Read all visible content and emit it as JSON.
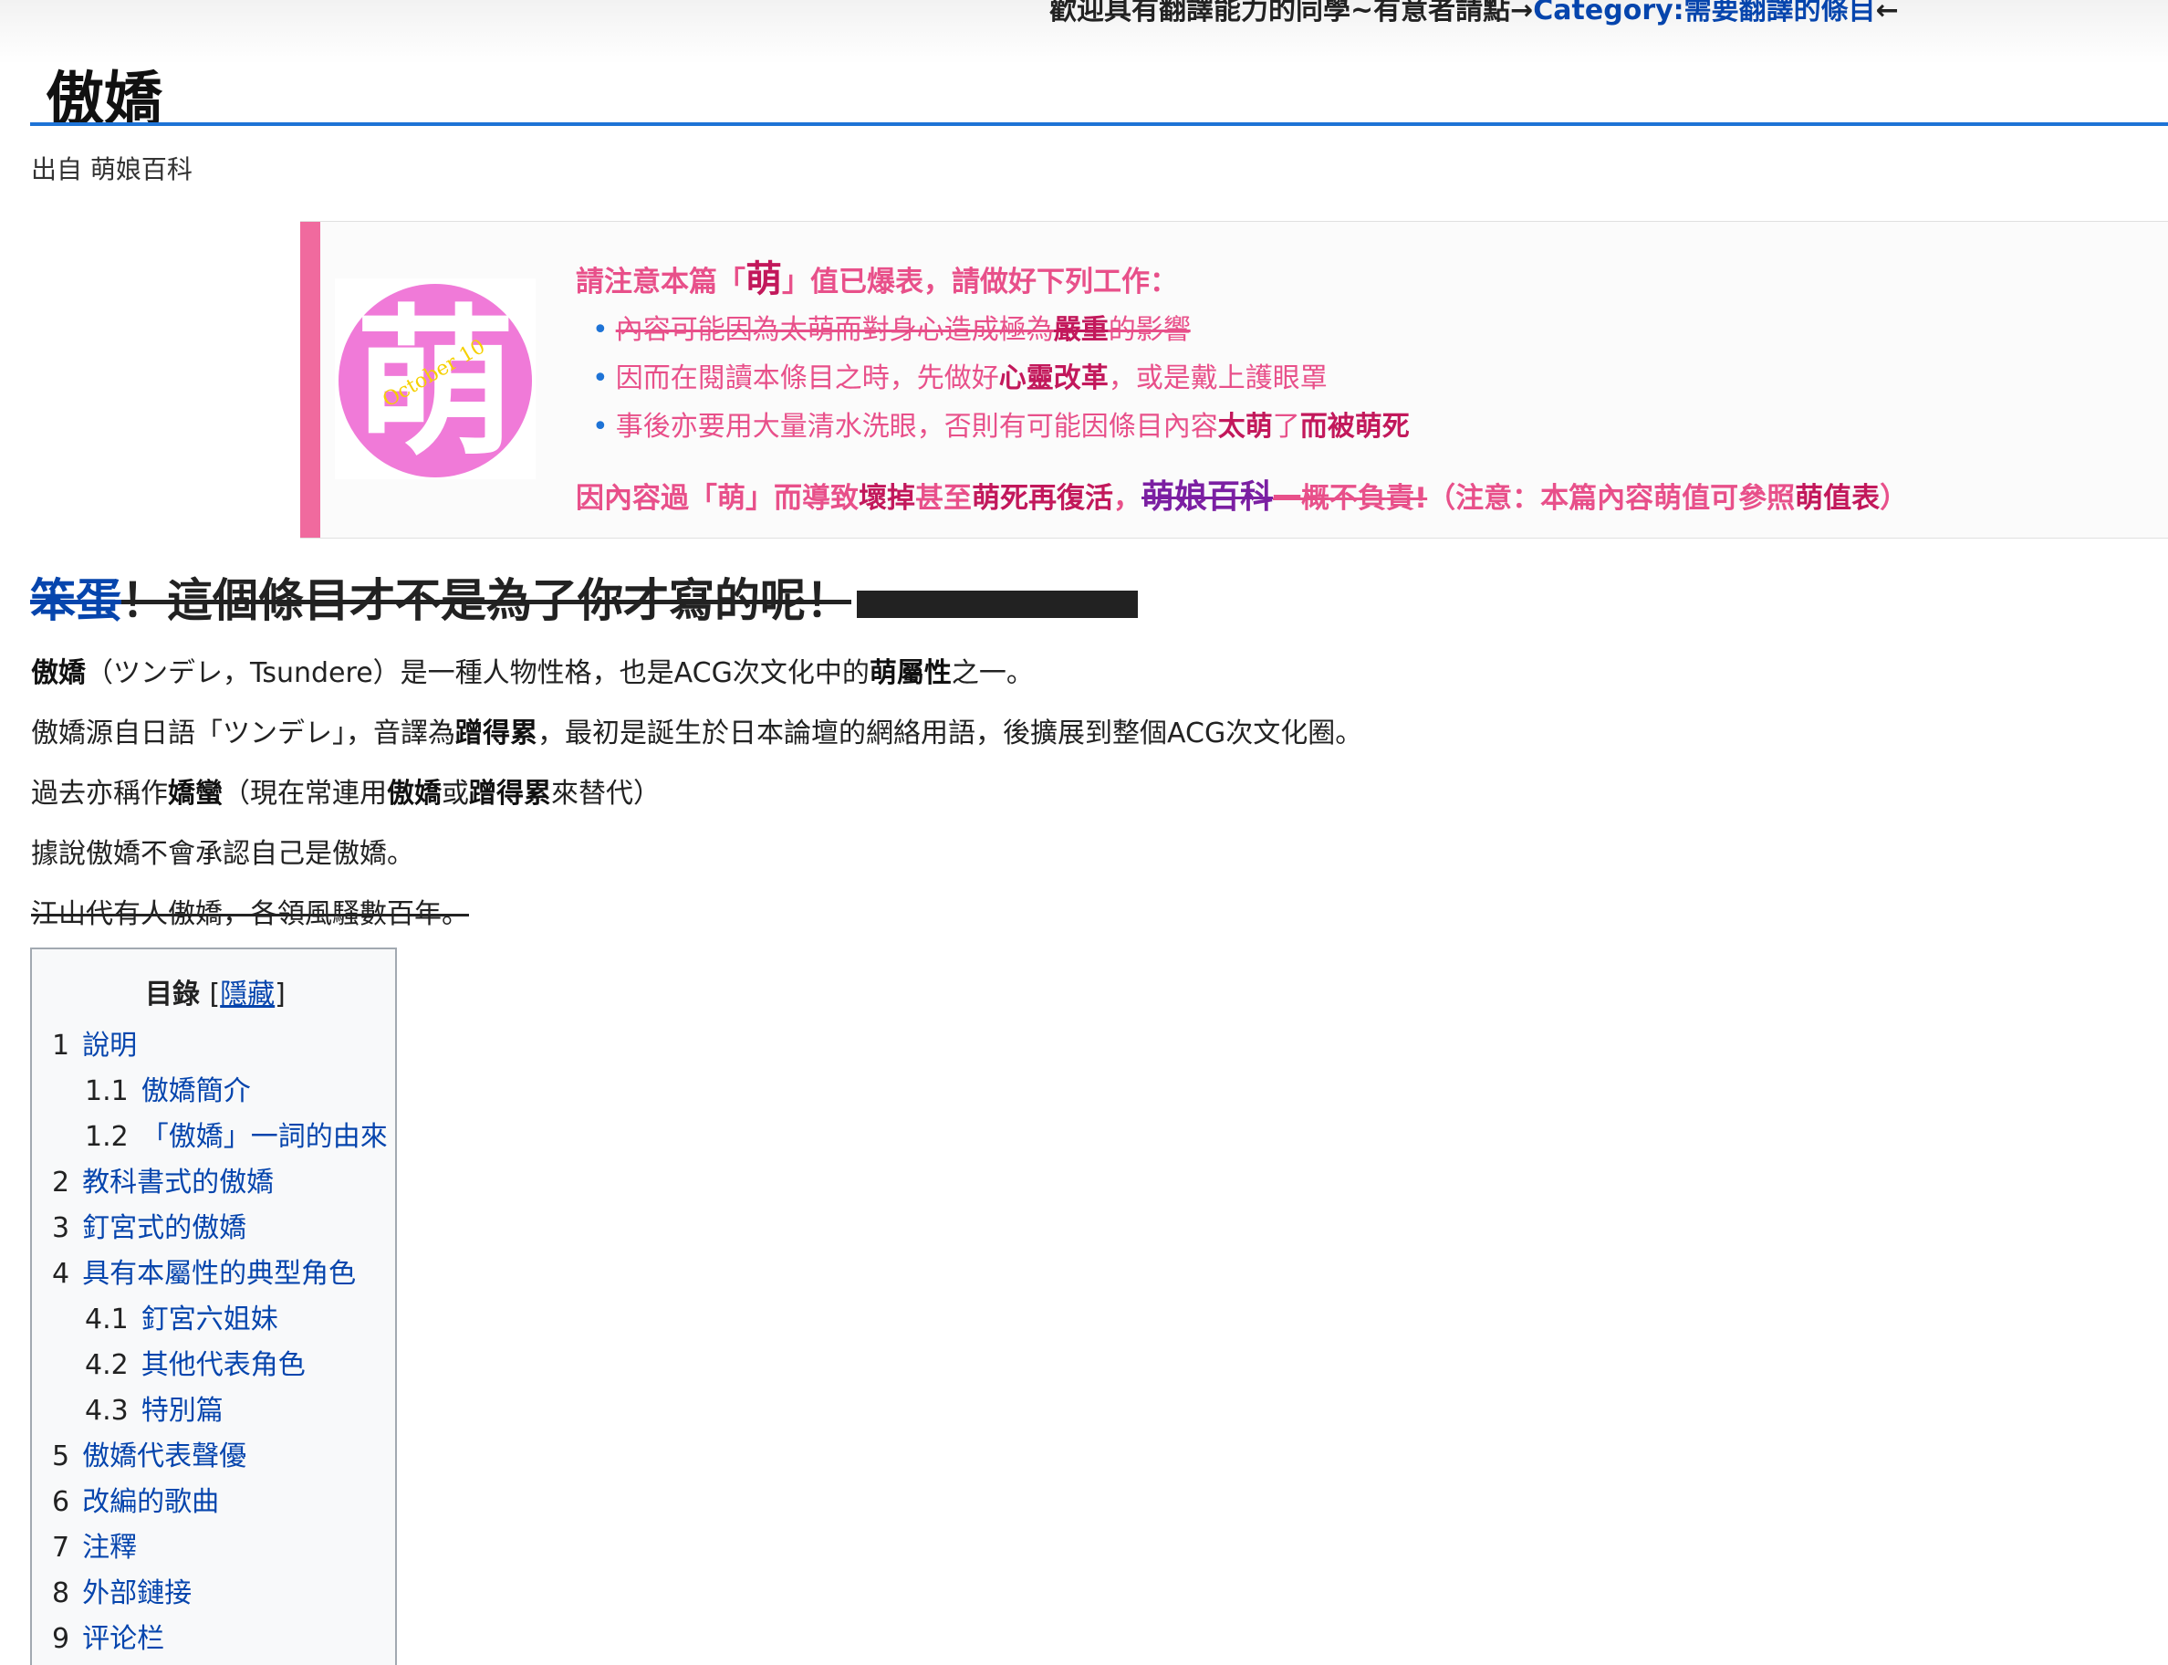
{
  "banner": {
    "text": "歡迎具有翻譯能力的同學~有意者請點→",
    "link": "Category:需要翻譯的條目",
    "arrow": "←"
  },
  "title": "傲嬌",
  "site_sub": "出自 萌娘百科",
  "notice": {
    "head_pre": "請注意本篇「",
    "head_big": "萌",
    "head_post": "」值已爆表，請做好下列工作：",
    "logo_text": "萌",
    "logo_sub": "October 10",
    "items": [
      {
        "del_pre": "內容可能因為太萌而對身心造成極為",
        "bold": "嚴重",
        "del_post": "的影響"
      },
      {
        "pre": "因而在閱讀本條目之時，先做好",
        "bold": "心靈改革",
        "post": "，或是戴上護眼罩"
      },
      {
        "pre": "事後亦要用大量清水洗眼，否則有可能因條目內容",
        "bold": "太萌",
        "mid": "了",
        "bold2": "而被萌死"
      }
    ],
    "foot_1": "因內容過「萌」而導致",
    "foot_2": "壞掉",
    "foot_3": "甚至",
    "foot_4": "萌死再復活",
    "foot_5": "，",
    "foot_site": "萌娘百科",
    "foot_6": "一概不負責!",
    "foot_7": "（注意：本篇內容萌值可參照",
    "foot_8": "萌值表",
    "foot_9": "）"
  },
  "strike_heading": {
    "link": "笨蛋",
    "main": "！這個條目才不是為了你才寫的呢！"
  },
  "paragraphs": {
    "p1": {
      "b1": "傲嬌",
      "t1": "（ツンデレ，Tsundere）是一種人物性格，也是ACG次文化中的",
      "b2": "萌屬性",
      "t2": "之一。"
    },
    "p2": {
      "t1": "傲嬌源自日語「ツンデレ」，音譯為",
      "b1": "蹭得累",
      "t2": "，最初是誕生於日本論壇的網絡用語，後擴展到整個ACG次文化圈。"
    },
    "p3": {
      "t1": "過去亦稱作",
      "b1": "嬌蠻",
      "t2": "（現在常連用",
      "b2": "傲嬌",
      "t3": "或",
      "b3": "蹭得累",
      "t4": "來替代）"
    },
    "p4": "據說傲嬌不會承認自己是傲嬌。",
    "p5": "江山代有人傲嬌，各領風騷數百年。"
  },
  "toc": {
    "title": "目錄",
    "toggle_open": "[",
    "toggle_label": "隱藏",
    "toggle_close": "]",
    "items": [
      {
        "num": "1",
        "label": "說明"
      },
      {
        "num": "1.1",
        "label": "傲嬌簡介"
      },
      {
        "num": "1.2",
        "label": "「傲嬌」一詞的由來"
      },
      {
        "num": "2",
        "label": "教科書式的傲嬌"
      },
      {
        "num": "3",
        "label": "釘宮式的傲嬌"
      },
      {
        "num": "4",
        "label": "具有本屬性的典型角色"
      },
      {
        "num": "4.1",
        "label": "釘宮六姐妹"
      },
      {
        "num": "4.2",
        "label": "其他代表角色"
      },
      {
        "num": "4.3",
        "label": "特別篇"
      },
      {
        "num": "5",
        "label": "傲嬌代表聲優"
      },
      {
        "num": "6",
        "label": "改編的歌曲"
      },
      {
        "num": "7",
        "label": "注釋"
      },
      {
        "num": "8",
        "label": "外部鏈接"
      },
      {
        "num": "9",
        "label": "评论栏"
      }
    ]
  }
}
